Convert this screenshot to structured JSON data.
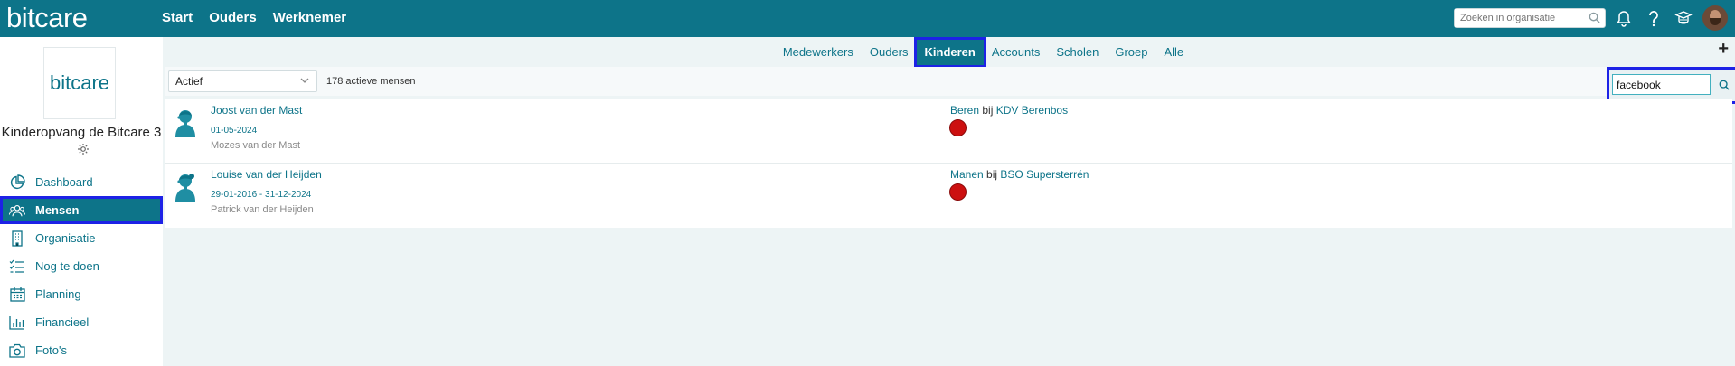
{
  "app": {
    "logo": "bitcare"
  },
  "topnav": {
    "items": [
      "Start",
      "Ouders",
      "Werknemer"
    ]
  },
  "topsearch": {
    "placeholder": "Zoeken in organisatie"
  },
  "topicons": [
    "bell-icon",
    "help-icon",
    "graduation-cap-icon"
  ],
  "sidebar": {
    "org_logo": "bitcare",
    "org_name": "Kinderopvang de Bitcare 3",
    "items": [
      {
        "label": "Dashboard",
        "icon": "pie-chart-icon"
      },
      {
        "label": "Mensen",
        "icon": "people-icon",
        "active": true
      },
      {
        "label": "Organisatie",
        "icon": "building-icon"
      },
      {
        "label": "Nog te doen",
        "icon": "checklist-icon"
      },
      {
        "label": "Planning",
        "icon": "calendar-icon"
      },
      {
        "label": "Financieel",
        "icon": "bar-chart-icon"
      },
      {
        "label": "Foto's",
        "icon": "camera-icon"
      }
    ]
  },
  "tabs": {
    "items": [
      "Medewerkers",
      "Ouders",
      "Kinderen",
      "Accounts",
      "Scholen",
      "Groep",
      "Alle"
    ],
    "active": "Kinderen"
  },
  "filter": {
    "status_selected": "Actief",
    "count_text": "178 actieve mensen",
    "search_value": "facebook"
  },
  "people": [
    {
      "name": "Joost van der Mast",
      "dates": "01-05-2024",
      "parent": "Mozes van der Mast",
      "group": "Beren",
      "bij": "bij",
      "location": "KDV Berenbos",
      "status_color": "#cc1010"
    },
    {
      "name": "Louise van der Heijden",
      "dates": "29-01-2016 - 31-12-2024",
      "parent": "Patrick van der Heijden",
      "group": "Manen",
      "bij": "bij",
      "location": "BSO Supersterrén",
      "status_color": "#cc1010"
    }
  ],
  "colors": {
    "brand": "#0d7489",
    "highlight": "#1d22e6",
    "status_red": "#cc1010"
  }
}
